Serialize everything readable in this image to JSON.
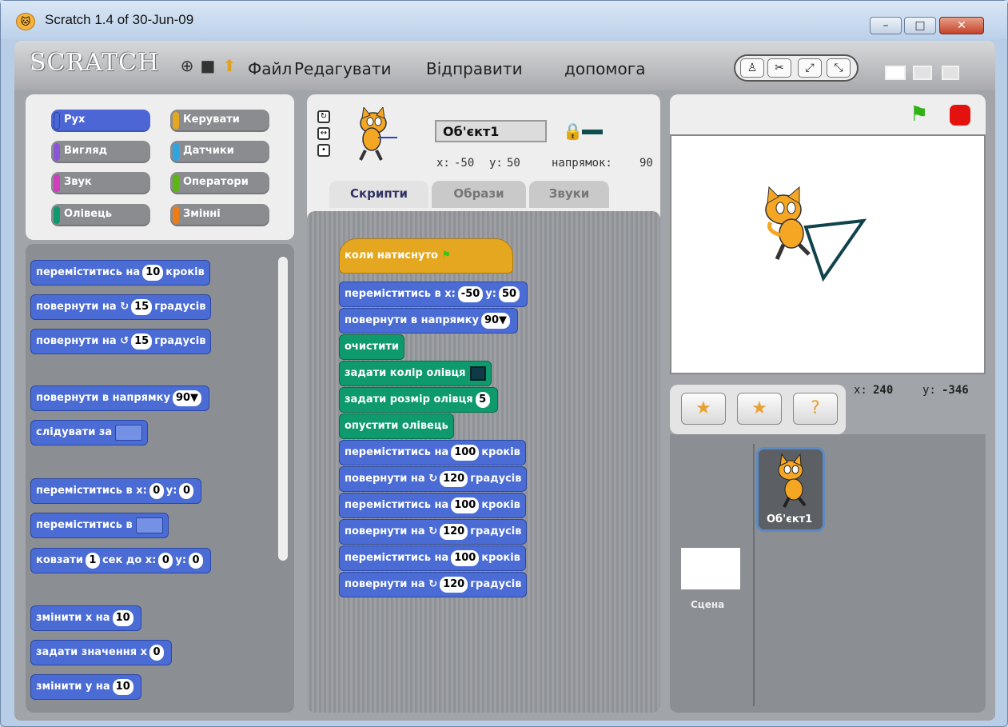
{
  "window": {
    "title": "Scratch 1.4 of 30-Jun-09",
    "minimize": "–",
    "maximize": "□",
    "close": "✕"
  },
  "menubar": {
    "logo": "SCRATCH",
    "items": [
      "Файл",
      "Редагувати",
      "Відправити",
      "допомога"
    ]
  },
  "categories": [
    {
      "label": "Рух",
      "color": "#4c66d6",
      "selected": true
    },
    {
      "label": "Керувати",
      "color": "#e4a71f"
    },
    {
      "label": "Вигляд",
      "color": "#8a55d7"
    },
    {
      "label": "Датчики",
      "color": "#2ca5e2"
    },
    {
      "label": "Звук",
      "color": "#cf3cbd"
    },
    {
      "label": "Оператори",
      "color": "#5cb712"
    },
    {
      "label": "Олівець",
      "color": "#0e9a6c"
    },
    {
      "label": "Змінні",
      "color": "#ee7d16"
    }
  ],
  "palette": {
    "b1": {
      "a": "переміститись на",
      "v": "10",
      "b": "кроків"
    },
    "b2": {
      "a": "повернути на",
      "v": "15",
      "b": "градусів"
    },
    "b3": {
      "a": "повернути на",
      "v": "15",
      "b": "градусів"
    },
    "b4": {
      "a": "повернути в напрямку",
      "v": "90▼"
    },
    "b5": {
      "a": "слідувати за"
    },
    "b6": {
      "a": "переміститись в x:",
      "v": "0",
      "b": "y:",
      "w": "0"
    },
    "b7": {
      "a": "переміститись в"
    },
    "b8": {
      "a": "ковзати",
      "v": "1",
      "b": "сек до x:",
      "w": "0",
      "c": "y:",
      "z": "0"
    },
    "b9": {
      "a": "змінити x на",
      "v": "10"
    },
    "b10": {
      "a": "задати значення x",
      "v": "0"
    },
    "b11": {
      "a": "змінити y на",
      "v": "10"
    }
  },
  "sprite": {
    "name": "Об'єкт1",
    "x_label": "x:",
    "x": "-50",
    "y_label": "y:",
    "y": "50",
    "dir_label": "напрямок:",
    "dir": "90"
  },
  "tabs": [
    "Скрипти",
    "Образи",
    "Звуки"
  ],
  "script": {
    "hat": "коли натиснуто",
    "s1": {
      "a": "переміститись в x:",
      "v": "-50",
      "b": "y:",
      "w": "50"
    },
    "s2": {
      "a": "повернути в напрямку",
      "v": "90▼"
    },
    "s3": {
      "a": "очистити"
    },
    "s4": {
      "a": "задати колір олівця"
    },
    "s5": {
      "a": "задати розмір олівця",
      "v": "5"
    },
    "s6": {
      "a": "опустити олівець"
    },
    "s7": {
      "a": "переміститись на",
      "v": "100",
      "b": "кроків"
    },
    "s8": {
      "a": "повернути на",
      "v": "120",
      "b": "градусів"
    },
    "s9": {
      "a": "переміститись на",
      "v": "100",
      "b": "кроків"
    },
    "s10": {
      "a": "повернути на",
      "v": "120",
      "b": "градусів"
    },
    "s11": {
      "a": "переміститись на",
      "v": "100",
      "b": "кроків"
    },
    "s12": {
      "a": "повернути на",
      "v": "120",
      "b": "градусів"
    }
  },
  "mouse": {
    "x_label": "x:",
    "x": "240",
    "y_label": "y:",
    "y": "-346"
  },
  "sprites_pane": {
    "stage_label": "Сцена",
    "sprite_label": "Об'єкт1"
  },
  "colors": {
    "motion": "#4a6cd4",
    "pen": "#0e9a6c",
    "control": "#e4a71f",
    "pen_color": "#0e3b46"
  }
}
